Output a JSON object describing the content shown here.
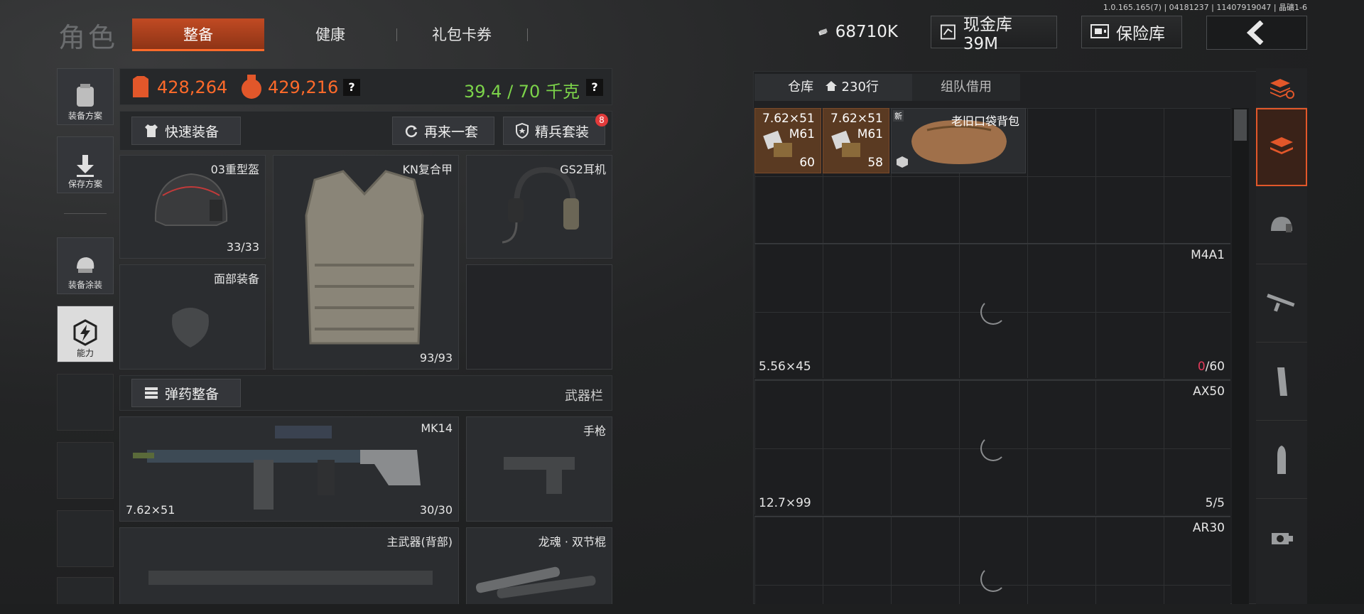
{
  "header": {
    "version": "1.0.165.165(7) | 04181237 | 11407919047 | 晶礦1-6",
    "title": "角色",
    "tabs": [
      {
        "label": "整备",
        "active": true
      },
      {
        "label": "健康",
        "active": false
      },
      {
        "label": "礼包卡券",
        "active": false
      }
    ],
    "money": "68710K",
    "cash_vault": "现金库 39M",
    "safe": "保险库"
  },
  "rail": [
    {
      "label": "装备方案",
      "icon": "backpack-icon"
    },
    {
      "label": "保存方案",
      "icon": "download-arrow-icon"
    },
    {
      "label": "装备涂装",
      "icon": "paint-helmet-icon"
    },
    {
      "label": "能力",
      "icon": "lightning-hexagon-icon"
    }
  ],
  "stats": {
    "value_a": "428,264",
    "value_b": "429,216",
    "weight": "39.4 / 70 千克",
    "help": "?"
  },
  "actions": {
    "quick_equip": "快速装备",
    "another_set": "再来一套",
    "elite_set": "精兵套装",
    "elite_badge": "8"
  },
  "equipment": {
    "helmet": {
      "name": "03重型盔",
      "durability": "33/33"
    },
    "armor": {
      "name": "KN复合甲",
      "durability": "93/93"
    },
    "headset": {
      "name": "GS2耳机"
    },
    "face": {
      "name": "面部装备"
    }
  },
  "ammo_bar": {
    "button": "弹药整备",
    "label": "武器栏"
  },
  "weapons": {
    "primary": {
      "name": "MK14",
      "caliber": "7.62×51",
      "ammo": "30/30"
    },
    "pistol": {
      "name": "手枪"
    },
    "back": {
      "name": "主武器(背部)"
    },
    "melee": {
      "name": "龙魂 · 双节棍"
    }
  },
  "warehouse": {
    "tab_storage": "仓库",
    "rows": "230行",
    "tab_team": "组队借用",
    "items": [
      {
        "title": "7.62×51",
        "sub": "M61",
        "count": "60"
      },
      {
        "title": "7.62×51",
        "sub": "M61",
        "count": "58"
      },
      {
        "title": "老旧口袋背包",
        "badge": "新"
      }
    ],
    "slots": [
      {
        "name": "M4A1",
        "caliber": "5.56×45",
        "count_used": "0",
        "count_max": "/60"
      },
      {
        "name": "AX50",
        "caliber": "12.7×99",
        "count": "5/5"
      },
      {
        "name": "AR30"
      }
    ]
  },
  "colors": {
    "accent": "#e2572a",
    "weight_green": "#7cd34a",
    "value_orange": "#ff6a2a"
  }
}
